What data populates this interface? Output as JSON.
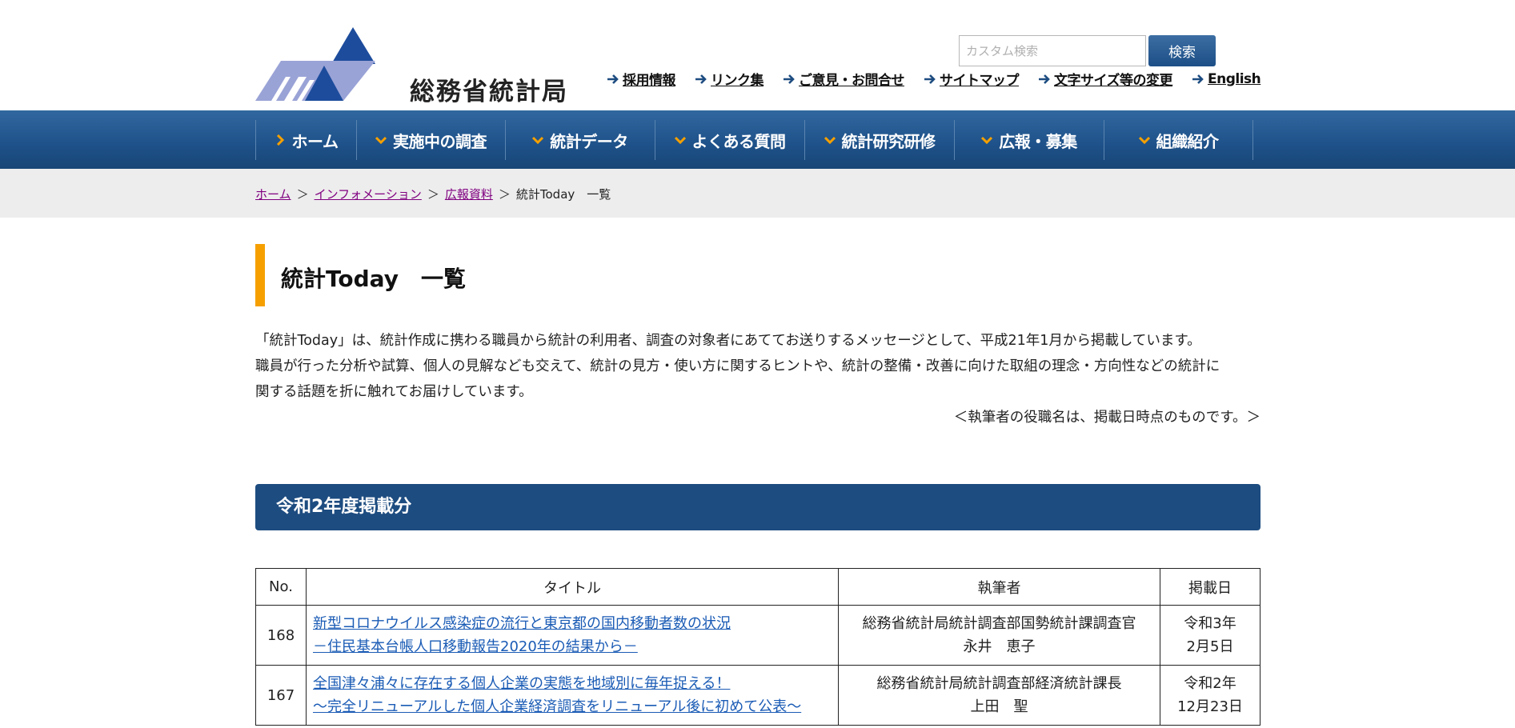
{
  "header": {
    "logo_text": "総務省統計局",
    "search_placeholder": "カスタム検索",
    "search_button": "検索",
    "util_links": [
      "採用情報",
      "リンク集",
      "ご意見・お問合せ",
      "サイトマップ",
      "文字サイズ等の変更",
      "English"
    ]
  },
  "nav": {
    "items": [
      "ホーム",
      "実施中の調査",
      "統計データ",
      "よくある質問",
      "統計研究研修",
      "広報・募集",
      "組織紹介"
    ]
  },
  "breadcrumb": {
    "links": [
      "ホーム",
      "インフォメーション",
      "広報資料"
    ],
    "separator": "＞",
    "current": "統計Today　一覧"
  },
  "main": {
    "title": "統計Today　一覧",
    "intro_lines": [
      "「統計Today」は、統計作成に携わる職員から統計の利用者、調査の対象者にあててお送りするメッセージとして、平成21年1月から掲載しています。",
      "職員が行った分析や試算、個人の見解なども交えて、統計の見方・使い方に関するヒントや、統計の整備・改善に向けた取組の理念・方向性などの統計に",
      "関する話題を折に触れてお届けしています。"
    ],
    "note": "＜執筆者の役職名は、掲載日時点のものです。＞",
    "section_title": "令和2年度掲載分",
    "table": {
      "headers": [
        "No.",
        "タイトル",
        "執筆者",
        "掲載日"
      ],
      "rows": [
        {
          "no": "168",
          "title1": "新型コロナウイルス感染症の流行と東京都の国内移動者数の状況",
          "title2": "－住民基本台帳人口移動報告2020年の結果から－",
          "author1": "総務省統計局統計調査部国勢統計課調査官",
          "author2": "永井　恵子",
          "date1": "令和3年",
          "date2": "2月5日"
        },
        {
          "no": "167",
          "title1": "全国津々浦々に存在する個人企業の実態を地域別に毎年捉える！",
          "title2": "～完全リニューアルした個人企業経済調査をリニューアル後に初めて公表～",
          "author1": "総務省統計局統計調査部経済統計課長",
          "author2": "上田　聖",
          "date1": "令和2年",
          "date2": "12月23日"
        }
      ]
    }
  },
  "colors": {
    "nav_blue": "#1e5189",
    "accent_orange": "#f5a000",
    "section_blue": "#1d4c80",
    "link_blue": "#1a5bb5",
    "visited_purple": "#800080"
  }
}
